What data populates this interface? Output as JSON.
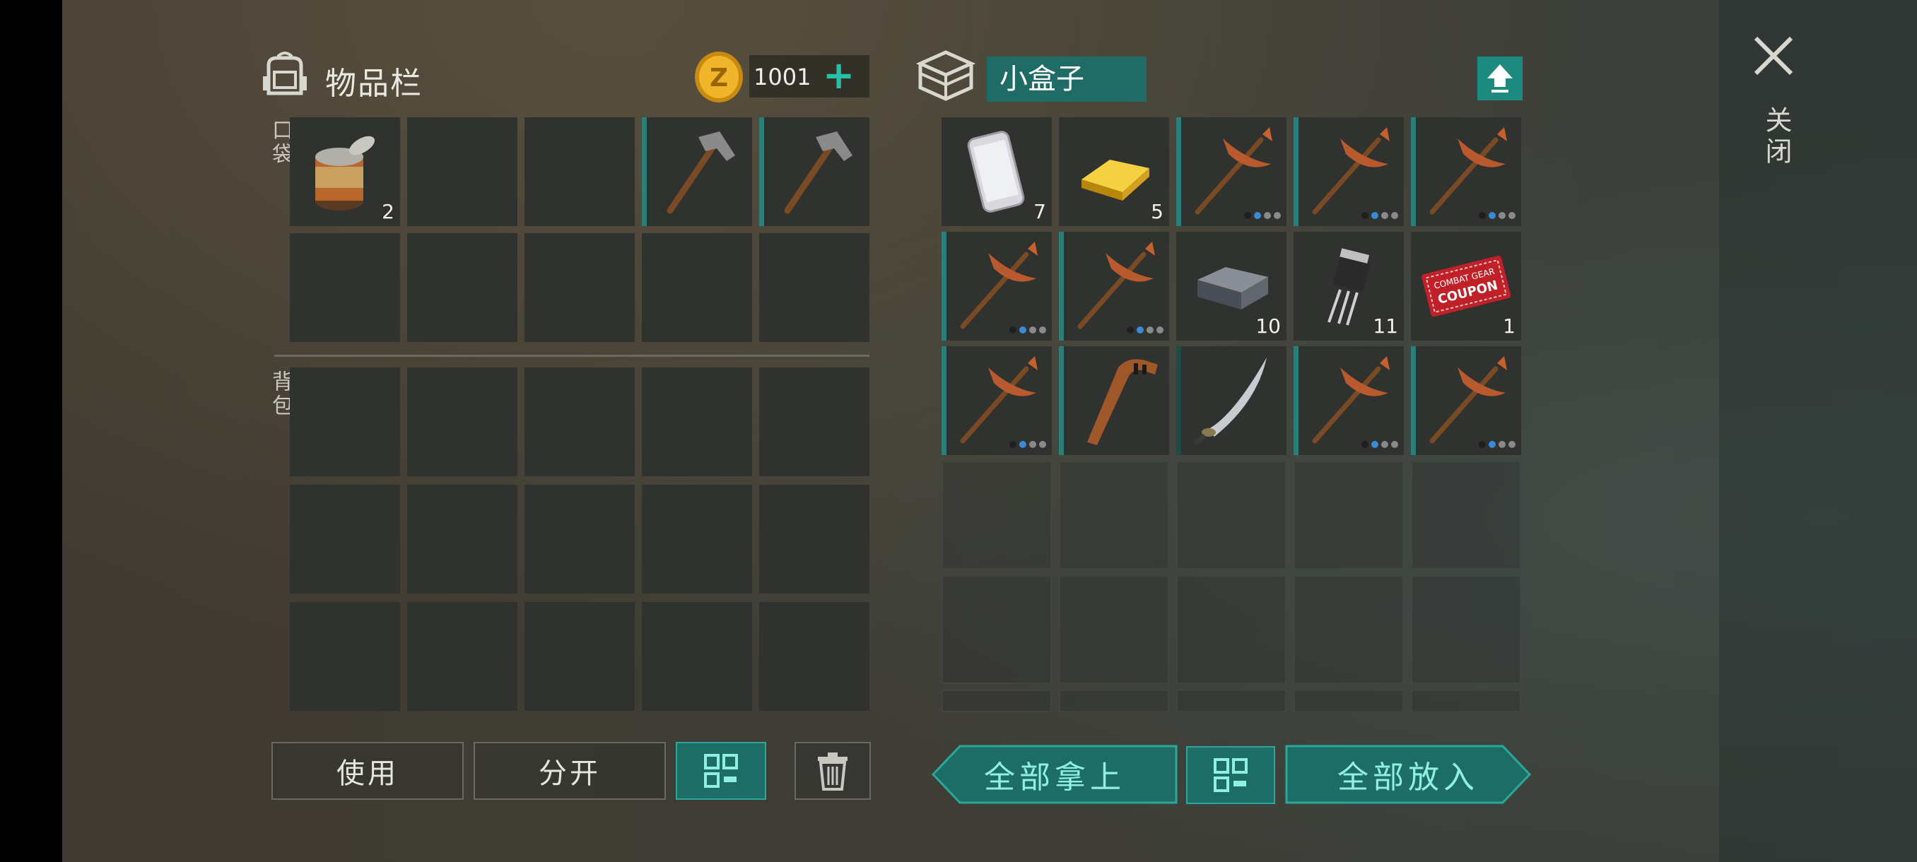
{
  "inventory": {
    "title": "物品栏",
    "coins": "1001",
    "pocket_label": "口袋",
    "backpack_label": "背包",
    "pocket_items": [
      {
        "name": "canned-food",
        "count": "2"
      },
      {
        "name": "empty",
        "count": ""
      },
      {
        "name": "empty",
        "count": ""
      },
      {
        "name": "hammer",
        "count": ""
      },
      {
        "name": "hammer",
        "count": ""
      }
    ]
  },
  "container": {
    "name": "小盒子",
    "items": [
      {
        "name": "smartphone",
        "count": "7"
      },
      {
        "name": "gold-bar",
        "count": "5"
      },
      {
        "name": "pickaxe",
        "count": ""
      },
      {
        "name": "pickaxe",
        "count": ""
      },
      {
        "name": "pickaxe",
        "count": ""
      },
      {
        "name": "pickaxe",
        "count": ""
      },
      {
        "name": "pickaxe",
        "count": ""
      },
      {
        "name": "metal-ingot",
        "count": "10"
      },
      {
        "name": "transistor",
        "count": "11"
      },
      {
        "name": "combat-gear-coupon",
        "count": "1",
        "text_lines": [
          "COMBAT GEAR",
          "COUPON"
        ]
      },
      {
        "name": "pickaxe",
        "count": ""
      },
      {
        "name": "hockey-stick",
        "count": ""
      },
      {
        "name": "sword",
        "count": ""
      },
      {
        "name": "pickaxe",
        "count": ""
      },
      {
        "name": "pickaxe",
        "count": ""
      }
    ]
  },
  "buttons": {
    "use": "使用",
    "split": "分开",
    "take_all": "全部拿上",
    "put_all": "全部放入",
    "close": "关闭"
  },
  "icons": [
    "backpack-icon",
    "coin-icon",
    "plus-icon",
    "box-icon",
    "upload-icon",
    "grid-sort-icon",
    "trash-icon",
    "close-icon"
  ],
  "colors": {
    "accent": "#1d8a80",
    "accent_light": "#8ff0e0",
    "slot": "#2f322f",
    "durability_blue": "#3a8ad8"
  }
}
